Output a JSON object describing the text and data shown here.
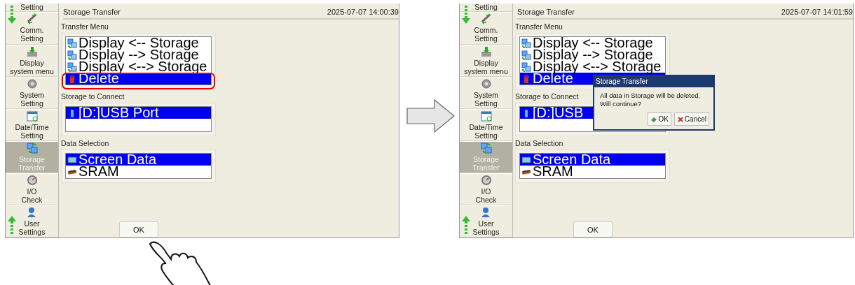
{
  "screens": [
    {
      "sidebar": {
        "items": [
          {
            "label": "Setting",
            "selected": false
          },
          {
            "label": "Comm.\nSetting",
            "selected": false
          },
          {
            "label": "Display\nsystem menu",
            "selected": false
          },
          {
            "label": "System\nSetting",
            "selected": false
          },
          {
            "label": "Date/Time\nSetting",
            "selected": false
          },
          {
            "label": "Storage\nTransfer",
            "selected": true
          },
          {
            "label": "I/O\nCheck",
            "selected": false
          },
          {
            "label": "User\nSettings",
            "selected": false
          }
        ]
      },
      "header": {
        "title": "Storage Transfer",
        "datetime": "2025-07-07 14:00:39"
      },
      "sections": [
        {
          "label": "Transfer Menu",
          "items": [
            {
              "label": "Display <-- Storage",
              "selected": false,
              "circled": false
            },
            {
              "label": "Display --> Storage",
              "selected": false,
              "circled": false
            },
            {
              "label": "Display <--> Storage",
              "selected": false,
              "circled": false
            },
            {
              "label": "Delete",
              "selected": true,
              "circled": true
            }
          ]
        },
        {
          "label": "Storage to Connect",
          "items": [
            {
              "label": "[D:]USB Port",
              "selected": true,
              "circled": false
            }
          ]
        },
        {
          "label": "Data Selection",
          "items": [
            {
              "label": "Screen Data",
              "selected": true,
              "circled": false
            },
            {
              "label": "SRAM",
              "selected": false,
              "circled": false
            }
          ]
        }
      ],
      "ok_button": {
        "label": "OK",
        "tapped": true
      }
    },
    {
      "sidebar": {
        "items": [
          {
            "label": "Setting",
            "selected": false
          },
          {
            "label": "Comm.\nSetting",
            "selected": false
          },
          {
            "label": "Display\nsystem menu",
            "selected": false
          },
          {
            "label": "System\nSetting",
            "selected": false
          },
          {
            "label": "Date/Time\nSetting",
            "selected": false
          },
          {
            "label": "Storage\nTransfer",
            "selected": true
          },
          {
            "label": "I/O\nCheck",
            "selected": false
          },
          {
            "label": "User\nSettings",
            "selected": false
          }
        ]
      },
      "header": {
        "title": "Storage Transfer",
        "datetime": "2025-07-07 14:01:59"
      },
      "sections": [
        {
          "label": "Transfer Menu",
          "items": [
            {
              "label": "Display <-- Storage",
              "selected": false,
              "circled": false
            },
            {
              "label": "Display --> Storage",
              "selected": false,
              "circled": false
            },
            {
              "label": "Display <--> Storage",
              "selected": false,
              "circled": false
            },
            {
              "label": "Delete",
              "selected": true,
              "circled": false
            }
          ]
        },
        {
          "label": "Storage to Connect",
          "items": [
            {
              "label": "[D:]USB",
              "selected": true,
              "circled": false
            }
          ]
        },
        {
          "label": "Data Selection",
          "items": [
            {
              "label": "Screen Data",
              "selected": true,
              "circled": false
            },
            {
              "label": "SRAM",
              "selected": false,
              "circled": false
            }
          ]
        }
      ],
      "ok_button": {
        "label": "OK"
      },
      "dialog": {
        "title": "Storage Transfer",
        "message": "All data in Storage will be deleted.\nWill continue?",
        "buttons": [
          "OK",
          "Cancel"
        ]
      }
    }
  ]
}
